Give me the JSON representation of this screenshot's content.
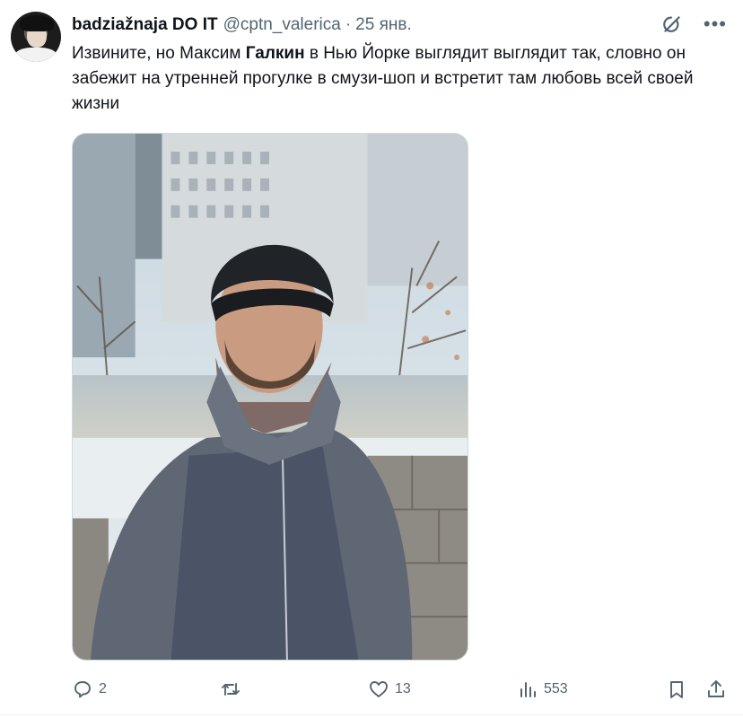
{
  "author": {
    "display_name": "badziažnaja DO IT",
    "handle": "@cptn_valerica",
    "separator": "·",
    "date": "25 янв."
  },
  "icons": {
    "grok": "grok-icon",
    "more": "more-icon",
    "reply": "reply-icon",
    "repost": "repost-icon",
    "like": "heart-icon",
    "views": "views-icon",
    "bookmark": "bookmark-icon",
    "share": "share-icon"
  },
  "tweet": {
    "text_before": "Извините, но Максим ",
    "text_bold": "Галкин",
    "text_after": " в Нью Йорке выглядит выглядит так, словно он забежит на утренней прогулке в смузи-шоп и встретит там любовь всей своей жизни"
  },
  "stats": {
    "replies": "2",
    "reposts": "",
    "likes": "13",
    "views": "553"
  },
  "colors": {
    "text": "#0f1419",
    "secondary": "#536471",
    "border": "#cfd9de"
  }
}
